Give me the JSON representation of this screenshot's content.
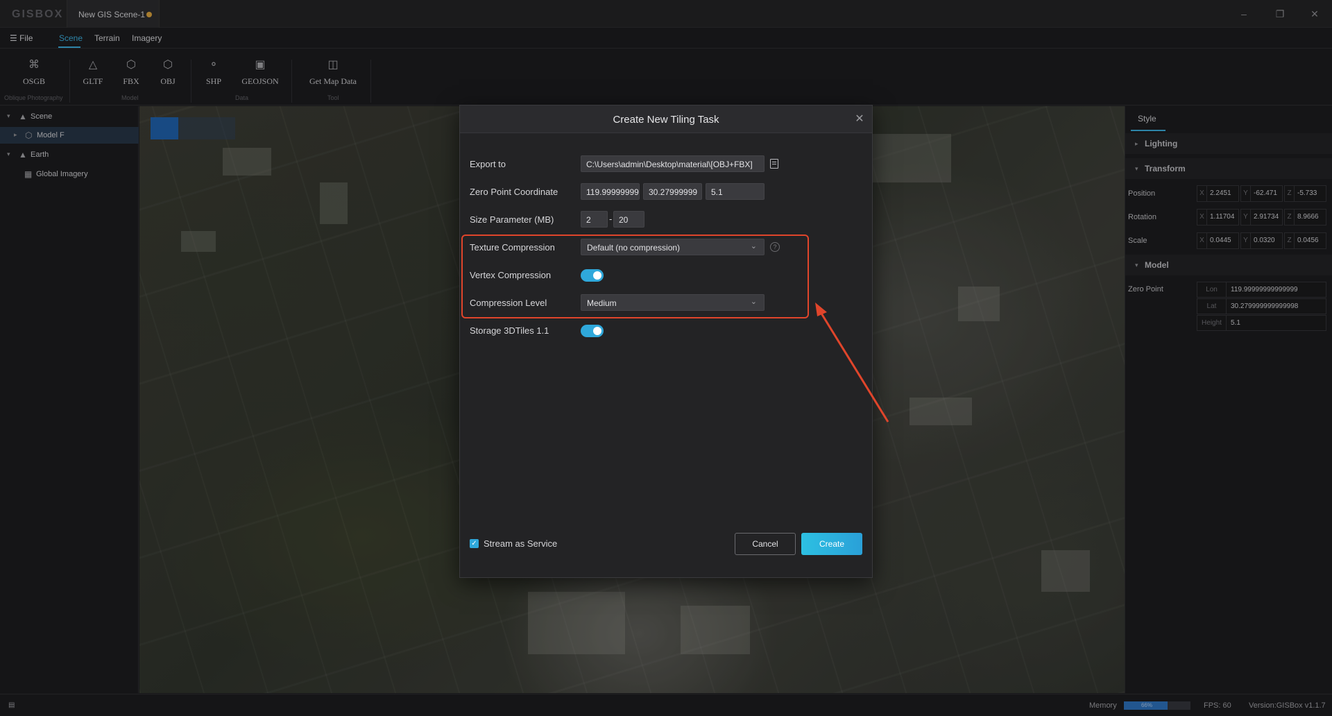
{
  "app": {
    "logo": "GISBOX",
    "document_tab": "New GIS Scene-1",
    "window_controls": [
      "minimize",
      "restore",
      "close"
    ]
  },
  "menu": {
    "file": "File",
    "tabs": [
      "Scene",
      "Terrain",
      "Imagery"
    ],
    "active_tab": "Scene"
  },
  "toolbar": {
    "tools": [
      {
        "label": "OSGB",
        "icon": "oblique-photo-icon"
      },
      {
        "label": "GLTF",
        "icon": "gltf-icon"
      },
      {
        "label": "FBX",
        "icon": "fbx-icon"
      },
      {
        "label": "OBJ",
        "icon": "obj-icon"
      },
      {
        "label": "SHP",
        "icon": "shp-icon"
      },
      {
        "label": "GEOJSON",
        "icon": "geojson-icon"
      },
      {
        "label": "Get Map Data",
        "icon": "map-bag-icon"
      }
    ],
    "groups": [
      "Oblique Photography",
      "Model",
      "Data",
      "Tool"
    ]
  },
  "tree": {
    "items": [
      {
        "label": "Scene",
        "icon": "scene-icon"
      },
      {
        "label": "Model F",
        "icon": "cube-icon",
        "selected": true
      },
      {
        "label": "Earth",
        "icon": "earth-icon"
      },
      {
        "label": "Global Imagery",
        "icon": "imagery-icon"
      }
    ]
  },
  "right_panel": {
    "tab": "Style",
    "sections": {
      "lighting": "Lighting",
      "transform": "Transform",
      "model": "Model"
    },
    "position": {
      "label": "Position",
      "x": "2.2451",
      "y": "-62.471",
      "z": "-5.733"
    },
    "rotation": {
      "label": "Rotation",
      "x": "1.11704",
      "y": "2.91734",
      "z": "8.9666"
    },
    "scale": {
      "label": "Scale",
      "x": "0.0445",
      "y": "0.0320",
      "z": "0.0456"
    },
    "zero_point": {
      "label": "Zero Point",
      "lon_key": "Lon",
      "lon": "119.99999999999999",
      "lat_key": "Lat",
      "lat": "30.279999999999998",
      "height_key": "Height",
      "height": "5.1"
    }
  },
  "status": {
    "memory_label": "Memory",
    "memory_percent_text": "66%",
    "memory_fraction": 0.66,
    "fps": "FPS: 60",
    "version": "Version:GISBox v1.1.7"
  },
  "dialog": {
    "title": "Create New Tiling Task",
    "export_label": "Export to",
    "export_path": "C:\\Users\\admin\\Desktop\\material\\[OBJ+FBX]",
    "zero_point_label": "Zero Point Coordinate",
    "zero_x": "119.99999999",
    "zero_y": "30.27999999",
    "zero_z": "5.1",
    "size_label": "Size Parameter (MB)",
    "size_min": "2",
    "size_separator": "-",
    "size_max": "20",
    "texture_label": "Texture Compression",
    "texture_value": "Default (no compression)",
    "vertex_label": "Vertex Compression",
    "vertex_on": true,
    "level_label": "Compression Level",
    "level_value": "Medium",
    "storage_label": "Storage 3DTiles 1.1",
    "storage_on": true,
    "stream_label": "Stream as Service",
    "stream_checked": true,
    "cancel": "Cancel",
    "create": "Create"
  },
  "colors": {
    "accent": "#2fa8db",
    "highlight": "#e0452b",
    "background": "#1e1e20"
  }
}
